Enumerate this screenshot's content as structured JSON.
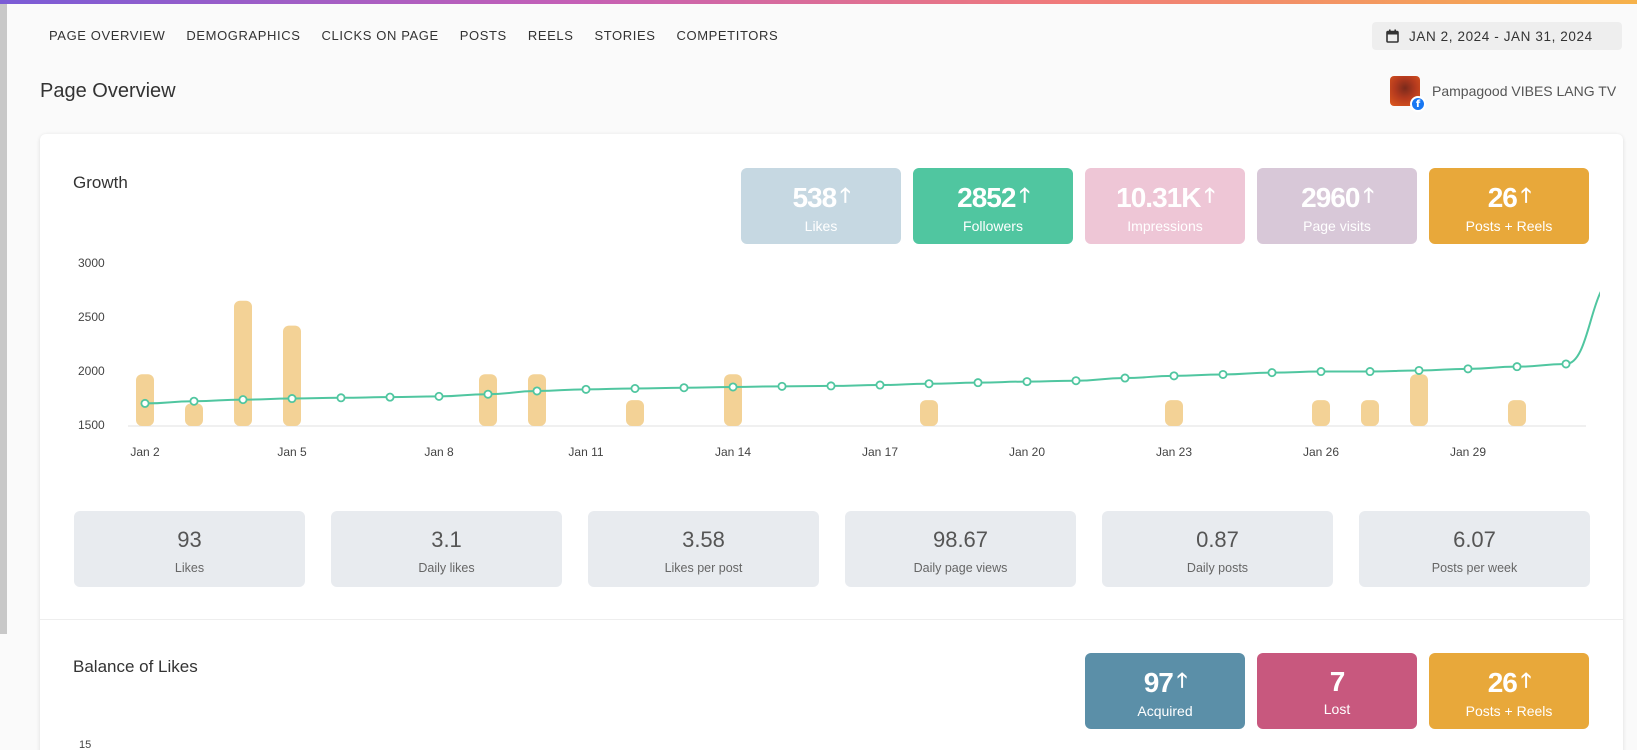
{
  "nav": {
    "items": [
      "PAGE OVERVIEW",
      "DEMOGRAPHICS",
      "CLICKS ON PAGE",
      "POSTS",
      "REELS",
      "STORIES",
      "COMPETITORS"
    ]
  },
  "date_range": "JAN 2, 2024 - JAN 31, 2024",
  "page": {
    "title": "Page Overview",
    "name": "Pampagood VIBES LANG TV"
  },
  "growth": {
    "title": "Growth",
    "kpis": [
      {
        "value": "538",
        "label": "Likes",
        "color": "#c6d8e2",
        "arrow": "🡑"
      },
      {
        "value": "2852",
        "label": "Followers",
        "color": "#50c6a0",
        "arrow": "🡑"
      },
      {
        "value": "10.31K",
        "label": "Impressions",
        "color": "#eec6d6",
        "arrow": "🡑"
      },
      {
        "value": "2960",
        "label": "Page visits",
        "color": "#d8c8d8",
        "arrow": "🡑"
      },
      {
        "value": "26",
        "label": "Posts + Reels",
        "color": "#e8a83a",
        "arrow": "🡑"
      }
    ],
    "stats": [
      {
        "value": "93",
        "label": "Likes"
      },
      {
        "value": "3.1",
        "label": "Daily likes"
      },
      {
        "value": "3.58",
        "label": "Likes per post"
      },
      {
        "value": "98.67",
        "label": "Daily page views"
      },
      {
        "value": "0.87",
        "label": "Daily posts"
      },
      {
        "value": "6.07",
        "label": "Posts per week"
      }
    ]
  },
  "balance": {
    "title": "Balance of Likes",
    "kpis": [
      {
        "value": "97",
        "label": "Acquired",
        "color": "#5b8fa8",
        "arrow": "🡑"
      },
      {
        "value": "7",
        "label": "Lost",
        "color": "#c8587e",
        "arrow": ""
      },
      {
        "value": "26",
        "label": "Posts + Reels",
        "color": "#e8a83a",
        "arrow": "🡑"
      }
    ],
    "y_first_tick": "15"
  },
  "chart_data": {
    "type": "line",
    "x_tick_labels": [
      "Jan 2",
      "Jan 5",
      "Jan 8",
      "Jan 11",
      "Jan 14",
      "Jan 17",
      "Jan 20",
      "Jan 23",
      "Jan 26",
      "Jan 29"
    ],
    "y_ticks": [
      1500,
      2000,
      2500,
      3000
    ],
    "ylim": [
      1500,
      3000
    ],
    "days": [
      2,
      3,
      4,
      5,
      6,
      7,
      8,
      9,
      10,
      11,
      12,
      13,
      14,
      15,
      16,
      17,
      18,
      19,
      20,
      21,
      22,
      23,
      24,
      25,
      26,
      27,
      28,
      29,
      30,
      31
    ],
    "series": [
      {
        "name": "Followers",
        "type": "line",
        "color": "#50c6a0",
        "values": [
          1700,
          1720,
          1735,
          1745,
          1752,
          1758,
          1765,
          1785,
          1815,
          1830,
          1838,
          1845,
          1852,
          1858,
          1862,
          1870,
          1882,
          1892,
          1902,
          1910,
          1935,
          1955,
          1968,
          1985,
          1995,
          1995,
          2005,
          2020,
          2040,
          2065,
          2850
        ]
      },
      {
        "name": "Posts",
        "type": "bar",
        "color": "#f3d296",
        "values": [
          1970,
          1700,
          2650,
          2420,
          0,
          0,
          0,
          1970,
          1970,
          0,
          1730,
          0,
          1970,
          0,
          0,
          0,
          1730,
          0,
          0,
          0,
          0,
          1730,
          0,
          0,
          1730,
          1730,
          1970,
          0,
          1730,
          0,
          0
        ]
      }
    ],
    "grid": false
  }
}
